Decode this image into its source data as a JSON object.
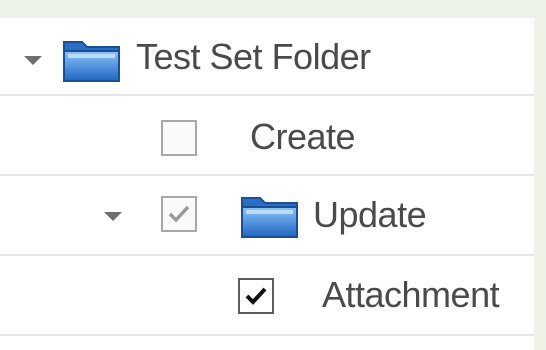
{
  "tree": {
    "items": [
      {
        "label": "Test Set Folder",
        "expanded": true,
        "icon": "folder-icon"
      },
      {
        "label": "Create",
        "checked": false
      },
      {
        "label": "Update",
        "checked": true,
        "checkbox_state": "checked-disabled",
        "expanded": true,
        "icon": "folder-icon"
      },
      {
        "label": "Attachment",
        "checked": true
      }
    ]
  },
  "colors": {
    "background": "#eef3e8",
    "text": "#4a4a4a",
    "folder_blue": "#2f7fd3",
    "checkbox_border": "#a9a9a9"
  }
}
